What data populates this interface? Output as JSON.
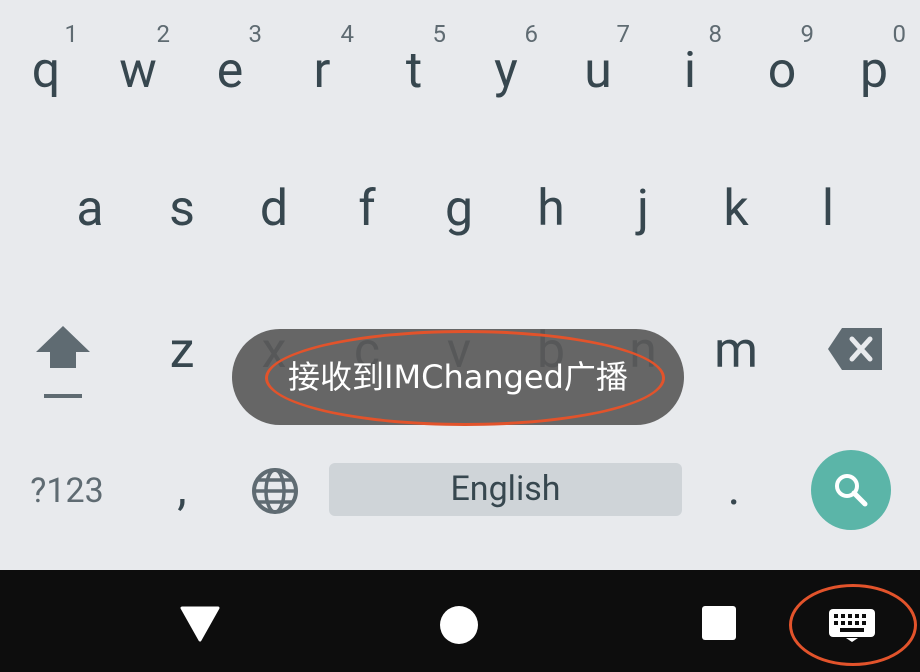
{
  "keyboard": {
    "row1": [
      {
        "char": "q",
        "hint": "1"
      },
      {
        "char": "w",
        "hint": "2"
      },
      {
        "char": "e",
        "hint": "3"
      },
      {
        "char": "r",
        "hint": "4"
      },
      {
        "char": "t",
        "hint": "5"
      },
      {
        "char": "y",
        "hint": "6"
      },
      {
        "char": "u",
        "hint": "7"
      },
      {
        "char": "i",
        "hint": "8"
      },
      {
        "char": "o",
        "hint": "9"
      },
      {
        "char": "p",
        "hint": "0"
      }
    ],
    "row2": [
      "a",
      "s",
      "d",
      "f",
      "g",
      "h",
      "j",
      "k",
      "l"
    ],
    "row3": [
      "z",
      "x",
      "c",
      "v",
      "b",
      "n",
      "m"
    ],
    "symbols_label": "?123",
    "comma": ",",
    "space_label": "English",
    "period": "."
  },
  "toast": {
    "text": "接收到IMChanged广播"
  },
  "colors": {
    "keyboard_bg": "#e8eaed",
    "key_text": "#37474f",
    "search_button": "#5bb5a8",
    "navbar_bg": "#0d0d0d",
    "annotation_ring": "#e2532b"
  },
  "icons": {
    "shift": "shift-icon",
    "delete": "backspace-icon",
    "globe": "globe-icon",
    "search": "search-icon",
    "back": "back-triangle-icon",
    "home": "home-circle-icon",
    "recents": "recents-square-icon",
    "keyboard_switch": "keyboard-icon"
  }
}
